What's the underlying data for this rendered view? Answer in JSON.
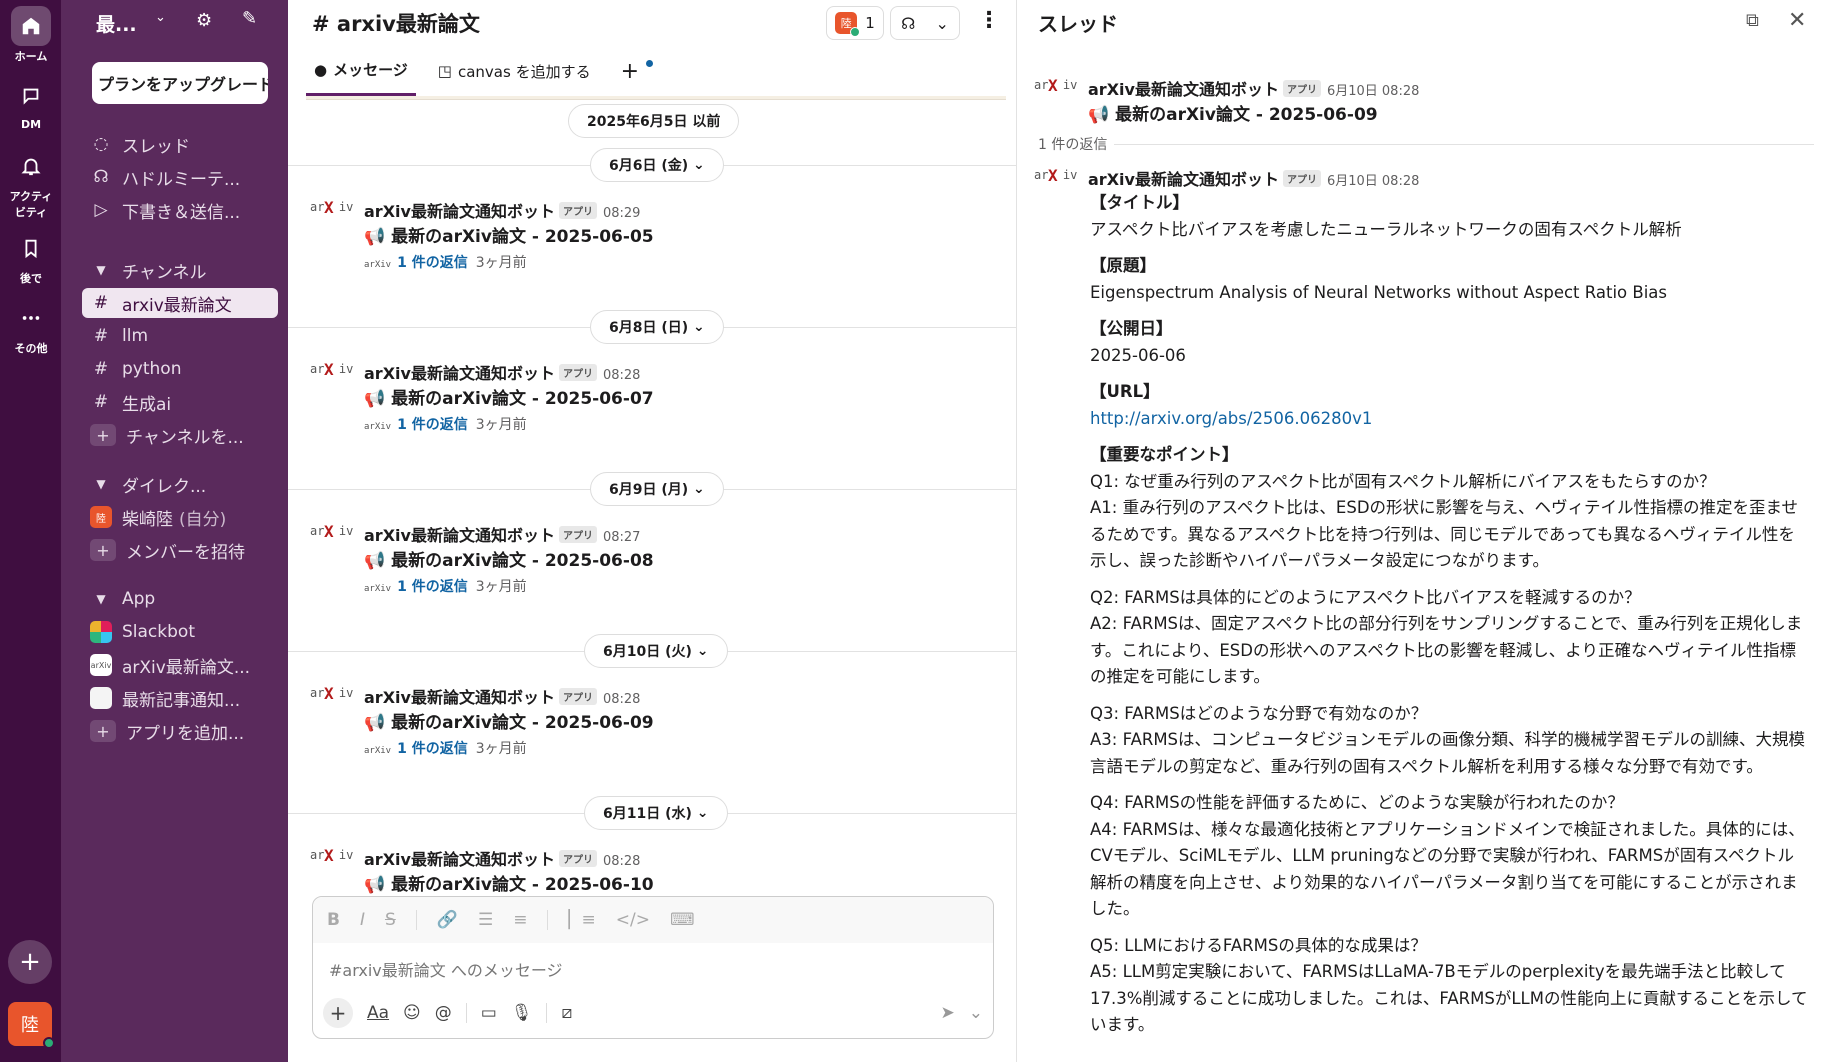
{
  "rail": {
    "items": [
      {
        "label": "ホーム",
        "icon": "home-icon"
      },
      {
        "label": "DM",
        "icon": "dm-icon"
      },
      {
        "label": "アクティビティ",
        "label_line1": "アクティ",
        "label_line2": "ビティ",
        "icon": "bell-icon"
      },
      {
        "label": "後で",
        "icon": "bookmark-icon"
      },
      {
        "label": "その他",
        "icon": "more-icon"
      }
    ],
    "avatar_initial": "陸"
  },
  "sidebar": {
    "workspace": "最...",
    "upgrade_label": "プランをアップグレード",
    "nav": [
      {
        "label": "スレッド"
      },
      {
        "label": "ハドルミーテ..."
      },
      {
        "label": "下書き＆送信..."
      }
    ],
    "channels_header": "チャンネル",
    "channels": [
      {
        "label": "arxiv最新論文"
      },
      {
        "label": "llm"
      },
      {
        "label": "python"
      },
      {
        "label": "生成ai"
      },
      {
        "label": "チャンネルを..."
      }
    ],
    "dm_header": "ダイレク...",
    "dms": [
      {
        "label": "柴崎陸",
        "suffix": "(自分)"
      },
      {
        "label": "メンバーを招待"
      }
    ],
    "app_header": "App",
    "apps": [
      {
        "label": "Slackbot"
      },
      {
        "label": "arXiv最新論文..."
      },
      {
        "label": "最新記事通知..."
      },
      {
        "label": "アプリを追加..."
      }
    ]
  },
  "channel": {
    "title": "# arxiv最新論文",
    "huddle_count": "1",
    "huddle_avatar": "陸",
    "tabs": [
      {
        "label": "メッセージ"
      },
      {
        "label": "canvas を追加する"
      }
    ],
    "top_pill": "2025年6月5日 以前",
    "groups": [
      {
        "date": "6月6日 (金)",
        "time": "08:29",
        "body": "最新のarXiv論文 - 2025-06-05"
      },
      {
        "date": "6月8日 (日)",
        "time": "08:28",
        "body": "最新のarXiv論文 - 2025-06-07"
      },
      {
        "date": "6月9日 (月)",
        "time": "08:27",
        "body": "最新のarXiv論文 - 2025-06-08"
      },
      {
        "date": "6月10日 (火)",
        "time": "08:28",
        "body": "最新のarXiv論文 - 2025-06-09"
      },
      {
        "date": "6月11日 (水)",
        "time": "08:28",
        "body": "最新のarXiv論文 - 2025-06-10"
      }
    ],
    "bot_name": "arXiv最新論文通知ボット",
    "app_tag": "アプリ",
    "reply_link": "1 件の返信",
    "reply_ago": "3ヶ月前",
    "composer_placeholder": "#arxiv最新論文 へのメッセージ"
  },
  "thread": {
    "title": "スレッド",
    "parent": {
      "name": "arXiv最新論文通知ボット",
      "time": "6月10日 08:28",
      "body": "最新のarXiv論文 - 2025-06-09"
    },
    "reply_count": "1 件の返信",
    "reply": {
      "name": "arXiv最新論文通知ボット",
      "time": "6月10日 08:28"
    },
    "sections": {
      "title_h": "【タイトル】",
      "title": "アスペクト比バイアスを考慮したニューラルネットワークの固有スペクトル解析",
      "orig_h": "【原題】",
      "orig": "Eigenspectrum Analysis of Neural Networks without Aspect Ratio Bias",
      "date_h": "【公開日】",
      "date": "2025-06-06",
      "url_h": "【URL】",
      "url": "http://arxiv.org/abs/2506.06280v1",
      "points_h": "【重要なポイント】"
    },
    "qa": [
      {
        "q": "Q1: なぜ重み行列のアスペクト比が固有スペクトル解析にバイアスをもたらすのか？",
        "a": "A1: 重み行列のアスペクト比は、ESDの形状に影響を与え、ヘヴィテイル性指標の推定を歪ませるためです。異なるアスペクト比を持つ行列は、同じモデルであっても異なるヘヴィテイル性を示し、誤った診断やハイパーパラメータ設定につながります。"
      },
      {
        "q": "Q2: FARMSは具体的にどのようにアスペクト比バイアスを軽減するのか？",
        "a": "A2: FARMSは、固定アスペクト比の部分行列をサンプリングすることで、重み行列を正規化します。これにより、ESDの形状へのアスペクト比の影響を軽減し、より正確なヘヴィテイル性指標の推定を可能にします。"
      },
      {
        "q": "Q3: FARMSはどのような分野で有効なのか？",
        "a": "A3: FARMSは、コンピュータビジョンモデルの画像分類、科学的機械学習モデルの訓練、大規模言語モデルの剪定など、重み行列の固有スペクトル解析を利用する様々な分野で有効です。"
      },
      {
        "q": "Q4: FARMSの性能を評価するために、どのような実験が行われたのか？",
        "a": "A4: FARMSは、様々な最適化技術とアプリケーションドメインで検証されました。具体的には、CVモデル、SciMLモデル、LLM pruningなどの分野で実験が行われ、FARMSが固有スペクトル解析の精度を向上させ、より効果的なハイパーパラメータ割り当てを可能にすることが示されました。"
      },
      {
        "q": "Q5: LLMにおけるFARMSの具体的な成果は？",
        "a": "A5: LLM剪定実験において、FARMSはLLaMA-7Bモデルのperplexityを最先端手法と比較して17.3%削減することに成功しました。これは、FARMSがLLMの性能向上に貢献することを示しています。"
      }
    ]
  }
}
